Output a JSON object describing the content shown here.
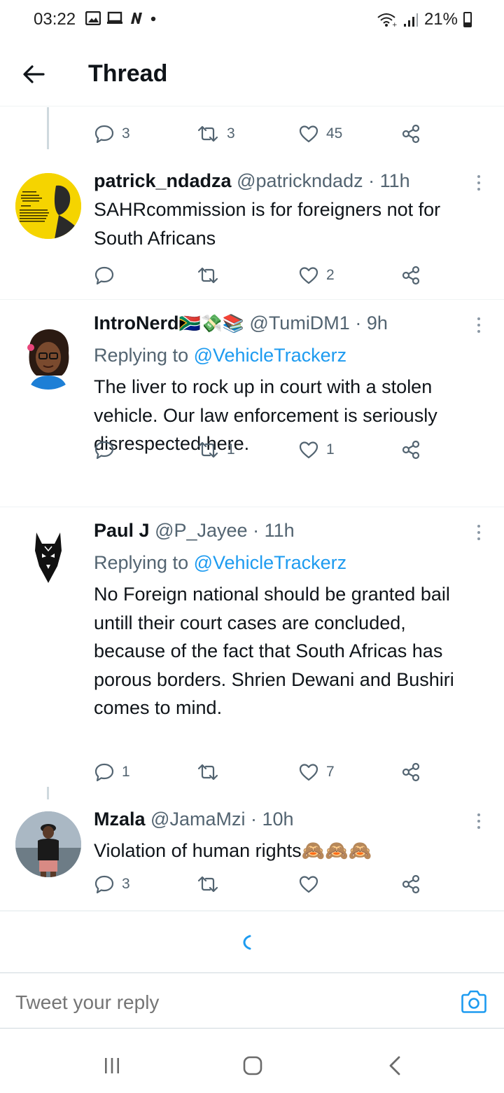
{
  "status_bar": {
    "time": "03:22",
    "battery": "21%",
    "left_icons": [
      "gallery-icon",
      "cast-icon",
      "n-app-icon",
      "dot-icon"
    ],
    "right_icons": [
      "wifi-icon",
      "signal-icon",
      "battery-icon"
    ]
  },
  "header": {
    "title": "Thread",
    "back_icon": "arrow-left-icon"
  },
  "colors": {
    "accent": "#1d9bf0",
    "secondary_text": "#536471",
    "primary_text": "#0f1419"
  },
  "top_actions": {
    "replies": "3",
    "retweets": "3",
    "likes": "45"
  },
  "tweets": [
    {
      "name": "patrick_ndadza",
      "handle": "@patrickndadz",
      "time": "11h",
      "replying_label": "",
      "replying_to": "",
      "text": "SAHRcommission is for foreigners not for South Africans",
      "replies": "",
      "retweets": "",
      "likes": "2"
    },
    {
      "name": "IntroNerd",
      "handle": "@TumiDM1",
      "time": "9h",
      "name_emoji": "🇿🇦💸📚",
      "replying_label": "Replying to",
      "replying_to": "@VehicleTrackerz",
      "text": "The liver to rock up in court with a stolen vehicle. Our law enforcement is seriously disrespected here.",
      "replies": "",
      "retweets": "1",
      "likes": "1"
    },
    {
      "name": "Paul J",
      "handle": "@P_Jayee",
      "time": "11h",
      "replying_label": "Replying to",
      "replying_to": "@VehicleTrackerz",
      "text": "No Foreign national should be granted bail untill their court cases are concluded, because of the fact that South Africas has porous borders. Shrien Dewani and Bushiri comes to mind.",
      "replies": "1",
      "retweets": "",
      "likes": "7"
    },
    {
      "name": "Mzala",
      "handle": "@JamaMzi",
      "time": "10h",
      "replying_label": "",
      "replying_to": "",
      "text": "Violation of human rights🙈🙈🙈",
      "replies": "3",
      "retweets": "",
      "likes": ""
    }
  ],
  "reply_box": {
    "placeholder": "Tweet your reply",
    "camera_icon": "camera-icon"
  },
  "nav_bar": {
    "icons": [
      "recents-icon",
      "home-icon",
      "back-icon"
    ]
  }
}
